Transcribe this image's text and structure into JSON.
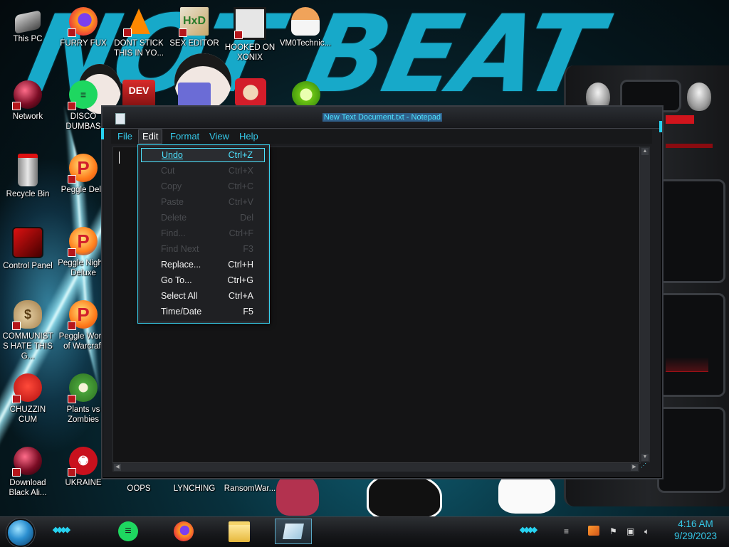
{
  "window": {
    "title": "New Text Document.txt - Notepad"
  },
  "menubar": {
    "items": [
      "File",
      "Edit",
      "Format",
      "View",
      "Help"
    ]
  },
  "edit_menu": {
    "items": [
      {
        "label": "Undo",
        "shortcut": "Ctrl+Z",
        "state": "hover"
      },
      {
        "label": "Cut",
        "shortcut": "Ctrl+X",
        "state": "disabled"
      },
      {
        "label": "Copy",
        "shortcut": "Ctrl+C",
        "state": "disabled"
      },
      {
        "label": "Paste",
        "shortcut": "Ctrl+V",
        "state": "disabled"
      },
      {
        "label": "Delete",
        "shortcut": "Del",
        "state": "disabled"
      },
      {
        "label": "Find...",
        "shortcut": "Ctrl+F",
        "state": "disabled"
      },
      {
        "label": "Find Next",
        "shortcut": "F3",
        "state": "disabled"
      },
      {
        "label": "Replace...",
        "shortcut": "Ctrl+H",
        "state": "enabled"
      },
      {
        "label": "Go To...",
        "shortcut": "Ctrl+G",
        "state": "enabled"
      },
      {
        "label": "Select All",
        "shortcut": "Ctrl+A",
        "state": "enabled"
      },
      {
        "label": "Time/Date",
        "shortcut": "F5",
        "state": "enabled"
      }
    ]
  },
  "desktop_icons": [
    {
      "label": "This PC",
      "icon": "computer-icon"
    },
    {
      "label": "FURRY FUX",
      "icon": "firefox-icon"
    },
    {
      "label": "DONT STICK THIS IN YO...",
      "icon": "vlc-cone-icon"
    },
    {
      "label": "SEX EDITOR",
      "icon": "hxd-icon"
    },
    {
      "label": "HOOKED ON XONIX",
      "icon": "xonix-icon"
    },
    {
      "label": "VM0Technic...",
      "icon": "doctor-icon"
    },
    {
      "label": "Network",
      "icon": "network-orb-icon"
    },
    {
      "label": "DISCO DUMBAS",
      "icon": "chat-icon"
    },
    {
      "label": "Recycle Bin",
      "icon": "recycle-bin-icon"
    },
    {
      "label": "Peggle Delu",
      "icon": "peggle-icon"
    },
    {
      "label": "Control Panel",
      "icon": "control-panel-icon"
    },
    {
      "label": "Peggle Nights Deluxe",
      "icon": "peggle-icon"
    },
    {
      "label": "COMMUNISTS HATE THIS G...",
      "icon": "money-bag-icon"
    },
    {
      "label": "Peggle World of Warcraft",
      "icon": "peggle-icon"
    },
    {
      "label": "CHUZZIN CUM",
      "icon": "chuzzle-icon"
    },
    {
      "label": "Plants vs Zombies",
      "icon": "plants-icon"
    },
    {
      "label": "Download Black Ali...",
      "icon": "alien-orb-icon"
    },
    {
      "label": "UKRAINE",
      "icon": "radiation-icon"
    },
    {
      "label": "OOPS",
      "icon": ""
    },
    {
      "label": "LYNCHING",
      "icon": ""
    },
    {
      "label": "RansomWar...",
      "icon": ""
    }
  ],
  "extra_icons": [
    "dev-cpp-icon",
    "id-card-icon",
    "santa-icon",
    "lime-icon"
  ],
  "wallpaper": {
    "text_top": "NOT BEAT"
  },
  "taskbar": {
    "pinned": [
      "chat-icon",
      "firefox-icon",
      "file-explorer-icon",
      "notepad-icon"
    ],
    "tray_icons": [
      "show-hidden-icon",
      "updater-icon",
      "flag-icon",
      "network-icon",
      "volume-icon"
    ],
    "time": "4:16 AM",
    "date": "9/29/2023"
  },
  "colors": {
    "accent": "#35c8e8",
    "menu_highlight": "#4ee3ff",
    "window_bg": "#1c1d20",
    "gadget_red": "#e0131b"
  }
}
